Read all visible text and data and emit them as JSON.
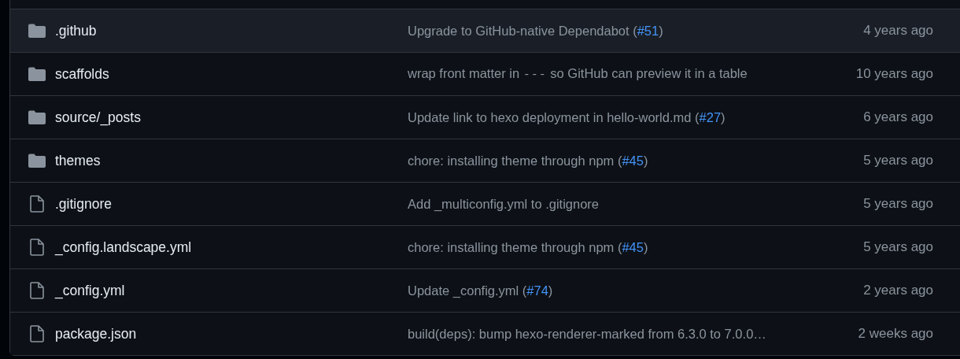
{
  "rows": [
    {
      "kind": "folder",
      "name": ".github",
      "hovered": true,
      "message": [
        {
          "kind": "text",
          "text": "Upgrade to GitHub-native Dependabot ("
        },
        {
          "kind": "link",
          "text": "#51"
        },
        {
          "kind": "text",
          "text": ")"
        }
      ],
      "age": "4 years ago"
    },
    {
      "kind": "folder",
      "name": "scaffolds",
      "hovered": false,
      "message": [
        {
          "kind": "text",
          "text": "wrap front matter in "
        },
        {
          "kind": "code",
          "text": "---"
        },
        {
          "kind": "text",
          "text": " so GitHub can preview it in a table"
        }
      ],
      "age": "10 years ago"
    },
    {
      "kind": "folder",
      "name": "source/_posts",
      "hovered": false,
      "message": [
        {
          "kind": "text",
          "text": "Update link to hexo deployment in hello-world.md ("
        },
        {
          "kind": "link",
          "text": "#27"
        },
        {
          "kind": "text",
          "text": ")"
        }
      ],
      "age": "6 years ago"
    },
    {
      "kind": "folder",
      "name": "themes",
      "hovered": false,
      "message": [
        {
          "kind": "text",
          "text": "chore: installing theme through npm ("
        },
        {
          "kind": "link",
          "text": "#45"
        },
        {
          "kind": "text",
          "text": ")"
        }
      ],
      "age": "5 years ago"
    },
    {
      "kind": "file",
      "name": ".gitignore",
      "hovered": false,
      "message": [
        {
          "kind": "text",
          "text": "Add _multiconfig.yml to .gitignore"
        }
      ],
      "age": "5 years ago"
    },
    {
      "kind": "file",
      "name": "_config.landscape.yml",
      "hovered": false,
      "message": [
        {
          "kind": "text",
          "text": "chore: installing theme through npm ("
        },
        {
          "kind": "link",
          "text": "#45"
        },
        {
          "kind": "text",
          "text": ")"
        }
      ],
      "age": "5 years ago"
    },
    {
      "kind": "file",
      "name": "_config.yml",
      "hovered": false,
      "message": [
        {
          "kind": "text",
          "text": "Update _config.yml ("
        },
        {
          "kind": "link",
          "text": "#74"
        },
        {
          "kind": "text",
          "text": ")"
        }
      ],
      "age": "2 years ago"
    },
    {
      "kind": "file",
      "name": "package.json",
      "hovered": false,
      "message": [
        {
          "kind": "text",
          "text": "build(deps): bump hexo-renderer-marked from 6.3.0 to 7.0.0…"
        }
      ],
      "age": "2 weeks ago"
    }
  ]
}
